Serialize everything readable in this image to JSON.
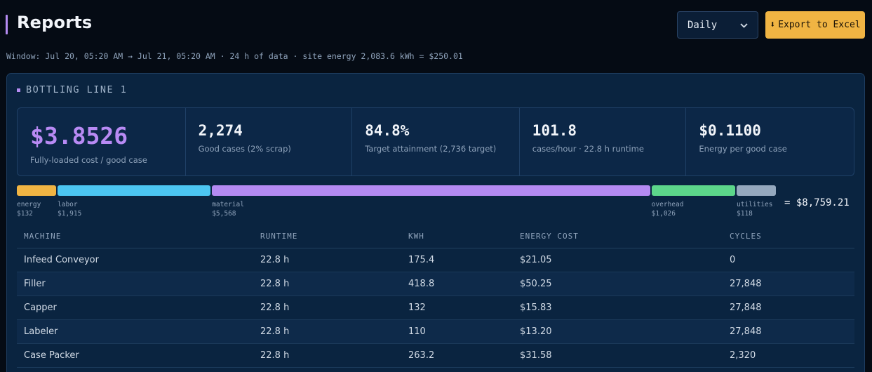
{
  "header": {
    "title": "Reports",
    "period_select": {
      "value": "Daily",
      "options": [
        "Daily"
      ]
    },
    "export_label": "Export to Excel",
    "export_icon": "⬇"
  },
  "window_line": "Window: Jul 20, 05:20 AM → Jul 21, 05:20 AM · 24 h of data · site energy 2,083.6 kWh = $250.01",
  "line": {
    "title": "BOTTLING LINE 1",
    "kpis": [
      {
        "value": "$3.8526",
        "label": "Fully-loaded cost / good case"
      },
      {
        "value": "2,274",
        "label": "Good cases (2% scrap)"
      },
      {
        "value": "84.8%",
        "label": "Target attainment (2,736 target)"
      },
      {
        "value": "101.8",
        "label": "cases/hour · 22.8 h runtime"
      },
      {
        "value": "$0.1100",
        "label": "Energy per good case"
      }
    ],
    "cost_breakdown": [
      {
        "name": "energy",
        "amount": "$132",
        "value": 132,
        "color": "#f0b443"
      },
      {
        "name": "labor",
        "amount": "$1,915",
        "value": 1915,
        "color": "#4cc6f2"
      },
      {
        "name": "material",
        "amount": "$5,568",
        "value": 5568,
        "color": "#b48af2"
      },
      {
        "name": "overhead",
        "amount": "$1,026",
        "value": 1026,
        "color": "#5cd68a"
      },
      {
        "name": "utilities",
        "amount": "$118",
        "value": 118,
        "color": "#95a8be"
      }
    ],
    "total": "= $8,759.21",
    "table": {
      "columns": [
        "MACHINE",
        "RUNTIME",
        "KWH",
        "ENERGY COST",
        "CYCLES"
      ],
      "rows": [
        [
          "Infeed Conveyor",
          "22.8 h",
          "175.4",
          "$21.05",
          "0"
        ],
        [
          "Filler",
          "22.8 h",
          "418.8",
          "$50.25",
          "27,848"
        ],
        [
          "Capper",
          "22.8 h",
          "132",
          "$15.83",
          "27,848"
        ],
        [
          "Labeler",
          "22.8 h",
          "110",
          "$13.20",
          "27,848"
        ],
        [
          "Case Packer",
          "22.8 h",
          "263.2",
          "$31.58",
          "2,320"
        ]
      ]
    }
  }
}
